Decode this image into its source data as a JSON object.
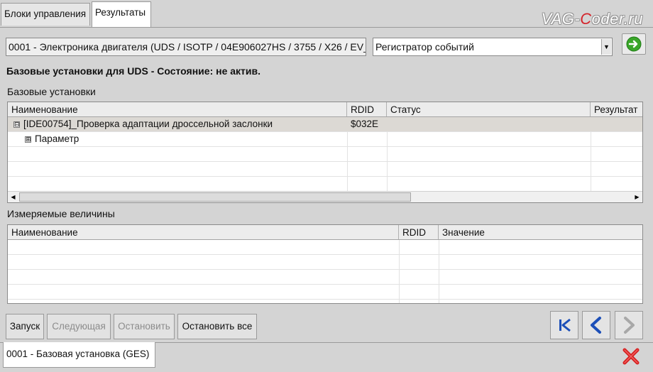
{
  "tabs": [
    {
      "label": "Блоки управления"
    },
    {
      "label": "Результаты"
    }
  ],
  "watermark": {
    "prefix": "VAG-",
    "accent": "C",
    "suffix": "oder.ru"
  },
  "module_address": "0001 - Электроника двигателя  (UDS / ISOTP / 04E906027HS / 3755 / X26 / EV_",
  "mode_select": {
    "value": "Регистратор событий"
  },
  "status_text": "Базовые установки для UDS - Состояние: не актив.",
  "basic_settings": {
    "title": "Базовые установки",
    "columns": [
      "Наименование",
      "RDID",
      "Статус",
      "Результат"
    ],
    "rows": [
      {
        "name": "[IDE00754]_Проверка адаптации дроссельной заслонки",
        "rdid": "$032E",
        "status": "",
        "result": "",
        "expander": "⊟",
        "selected": true
      },
      {
        "name": "Параметр",
        "rdid": "",
        "status": "",
        "result": "",
        "expander": "⊞",
        "selected": false
      }
    ]
  },
  "measured_values": {
    "title": "Измеряемые величины",
    "columns": [
      "Наименование",
      "RDID",
      "Значение"
    ]
  },
  "buttons": {
    "start": "Запуск",
    "next": "Следующая",
    "stop": "Остановить",
    "stop_all": "Остановить все"
  },
  "bottom_tab": "0001 - Базовая установка (GES)",
  "colors": {
    "nav_blue": "#1c4fb8",
    "close_red": "#d62020",
    "go_green": "#3aa629"
  }
}
